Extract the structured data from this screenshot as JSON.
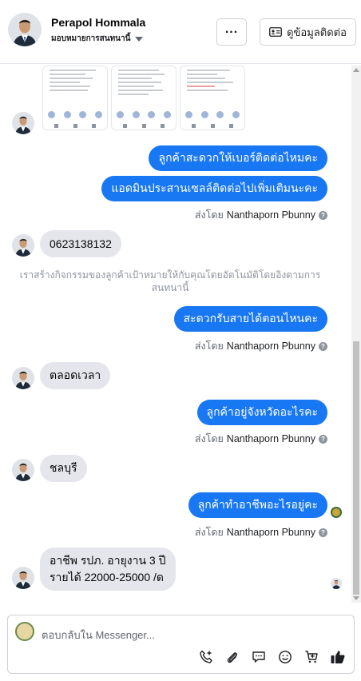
{
  "header": {
    "name": "Perapol Hommala",
    "assign_label": "มอบหมายการสนทนานี้",
    "more_label": "...",
    "contact_button_label": "ดูข้อมูลติดต่อ"
  },
  "messages": [
    {
      "type": "outgoing",
      "text": "ลูกค้าสะดวกให้เบอร์ติดต่อไหมคะ"
    },
    {
      "type": "outgoing",
      "text": "แอดมินประสานเซลล์ติดต่อไปเพิ่มเติมนะคะ"
    },
    {
      "type": "sent_by",
      "prefix": "ส่งโดย",
      "sender": "Nanthaporn Pbunny"
    },
    {
      "type": "incoming",
      "text": "0623138132"
    },
    {
      "type": "system",
      "text": "เราสร้างกิจกรรมของลูกค้าเป้าหมายให้กับคุณโดยอัตโนมัติโดยอิงตามการสนทนานี้"
    },
    {
      "type": "outgoing",
      "text": "สะดวกรับสายได้ตอนไหนคะ"
    },
    {
      "type": "sent_by",
      "prefix": "ส่งโดย",
      "sender": "Nanthaporn Pbunny"
    },
    {
      "type": "incoming",
      "text": "ตลอดเวลา"
    },
    {
      "type": "outgoing",
      "text": "ลูกค้าอยู่จังหวัดอะไรคะ"
    },
    {
      "type": "sent_by",
      "prefix": "ส่งโดย",
      "sender": "Nanthaporn Pbunny"
    },
    {
      "type": "incoming",
      "text": "ชลบุรี"
    },
    {
      "type": "outgoing",
      "text": "ลูกค้าทำอาชีพอะไรอยู่คะ"
    },
    {
      "type": "sent_by",
      "prefix": "ส่งโดย",
      "sender": "Nanthaporn Pbunny"
    },
    {
      "type": "incoming",
      "lines": [
        "อาชีพ รปภ. อายุงาน 3 ปี",
        "รายได้ 22000-25000 /ด"
      ]
    }
  ],
  "composer": {
    "placeholder": "ตอบกลับใน Messenger..."
  },
  "icons": {
    "call": "phone-plus-icon",
    "attach": "paperclip-icon",
    "saved_replies": "chat-bubble-icon",
    "emoji": "emoji-icon",
    "shop": "cart-plus-icon",
    "like": "thumbs-up-icon"
  },
  "colors": {
    "outgoing_bubble": "#1877f2",
    "incoming_bubble": "#e4e6eb",
    "muted_text": "#606770"
  }
}
